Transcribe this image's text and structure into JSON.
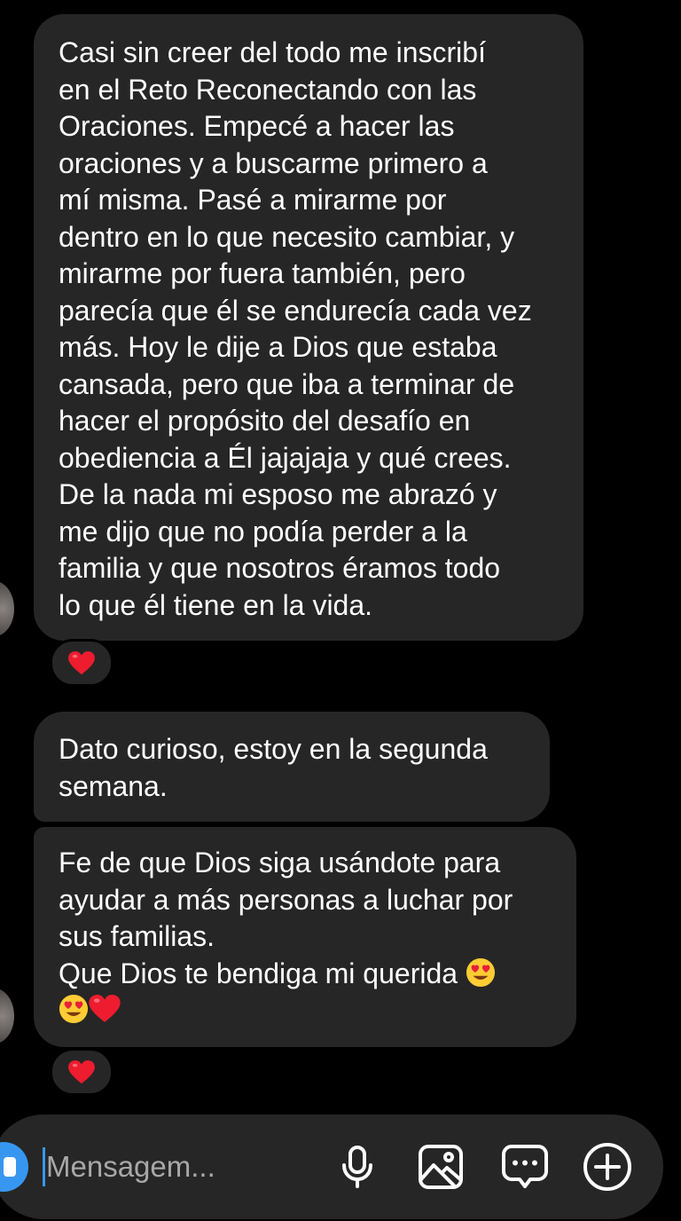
{
  "messages": [
    {
      "text": "Casi sin creer del todo me inscribí\nen el Reto Reconectando con las\nOraciones. Empecé a hacer las\noraciones y a buscarme primero a\nmí misma. Pasé a mirarme por\ndentro en lo que necesito cambiar, y\nmirarme por fuera también, pero\nparecía que él se endurecía cada vez\nmás. Hoy le dije a Dios que estaba\ncansada, pero que iba a terminar de\nhacer el propósito del desafío en\nobediencia a Él jajajaja y qué crees.\nDe la nada mi esposo me abrazó y\nme dijo que no podía perder a la\nfamilia y que nosotros éramos todo\nlo que él tiene en la vida.",
      "reaction": "heart-reaction"
    },
    {
      "text": "Dato curioso, estoy en la segunda\nsemana."
    },
    {
      "text_lines": "Fe de que Dios siga usándote para\nayudar a más personas a luchar por\nsus familias.\nQue Dios te bendiga mi querida",
      "emojis": [
        "heart-eyes-emoji",
        "heart-eyes-emoji",
        "red-heart-emoji"
      ],
      "reaction": "heart-reaction"
    }
  ],
  "composer": {
    "placeholder": "Mensagem...",
    "icons": [
      "camera-icon",
      "microphone-icon",
      "gallery-icon",
      "sticker-icon",
      "add-icon"
    ]
  },
  "colors": {
    "background": "#000000",
    "bubble": "#262626",
    "accent": "#3797f0",
    "heart": "#ed1c2e"
  }
}
